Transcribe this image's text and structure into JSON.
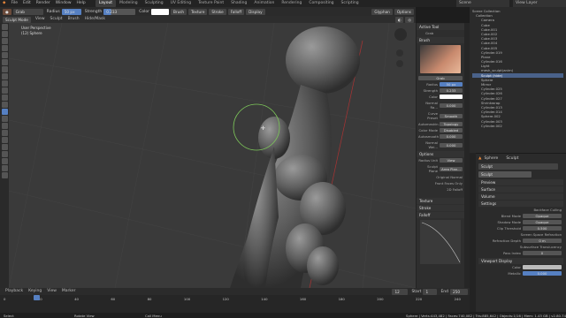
{
  "menu": [
    "File",
    "Edit",
    "Render",
    "Window",
    "Help"
  ],
  "workspaces": [
    "Layout",
    "Modeling",
    "Sculpting",
    "UV Editing",
    "Texture Paint",
    "Shading",
    "Animation",
    "Rendering",
    "Compositing",
    "Scripting"
  ],
  "scene_label": "Scene",
  "view_layer_label": "View Layer",
  "toolbar": {
    "brush": "Grab",
    "radius_label": "Radius",
    "radius": "50 px",
    "strength_label": "Strength",
    "strength": "0.233",
    "color_label": "Color",
    "brush_btn": "Brush",
    "texture_btn": "Texture",
    "stroke_btn": "Stroke",
    "falloff_btn": "Falloff",
    "display_btn": "Display",
    "orientation": "Glyphan",
    "options_btn": "Options"
  },
  "header3": {
    "mode": "Sculpt Mode",
    "view": "View",
    "sculpt": "Sculpt",
    "brush": "Brush",
    "hide_mask": "Hide/Mask"
  },
  "viewport": {
    "perspective": "User Perspective",
    "object": "(12) Sphere"
  },
  "npanel": {
    "active_tool": "Active Tool",
    "tool_name": "Grab",
    "brush_header": "Brush",
    "brush_name": "Grab",
    "radius_label": "Radius",
    "radius": "50 px",
    "strength_label": "Strength",
    "strength": "0.233",
    "color_label": "Color",
    "normal_radius_label": "Normal Ra...",
    "normal_radius": "0.000",
    "curve_preset_label": "Curve Preset",
    "curve_preset": "Smooth",
    "automasking_label": "Automaskin...",
    "automasking": "Topology",
    "color_mode_label": "Color Mode",
    "color_mode": "Disabled",
    "autosmooth_label": "Autosmooth",
    "autosmooth": "0.000",
    "normal_wei_label": "Normal Wei...",
    "normal_wei": "0.000",
    "options_header": "Options",
    "radius_unit_label": "Radius Unit",
    "radius_unit": "View",
    "sculpt_plane_label": "Sculpt Plane",
    "sculpt_plane": "Area Plan...",
    "original_normal": "Original Normal",
    "front_faces_only": "Front Faces Only",
    "falloff_2d": "2D Falloff",
    "texture_header": "Texture",
    "stroke_header": "Stroke",
    "falloff_header": "Falloff"
  },
  "outliner": {
    "title": "Scene Collection",
    "items": [
      "Collection",
      "Camera",
      "Cube",
      "Cube.001",
      "Cube.002",
      "Cube.003",
      "Cube.004",
      "Cube.005",
      "Cylinder.019",
      "Plane",
      "Cylinder.016",
      "Light",
      "mesh_sculpt(anim)",
      "Sculpt (hide)",
      "Sphere",
      "Mirror",
      "Cylinder.025",
      "Cylinder.026",
      "Cylinder.027",
      "Shrinkwrap",
      "Cylinder.013",
      "Cylinder.014",
      "Sphere.002",
      "Cylinder.003",
      "Cylinder.002"
    ]
  },
  "properties": {
    "object": "Sphere",
    "tab": "Sculpt",
    "material": "Sculpt",
    "sections": [
      "Preview",
      "Surface",
      "Volume",
      "Settings"
    ],
    "backface_culling": "Backface Culling",
    "blend_mode_label": "Blend Mode",
    "blend_mode": "Opaque",
    "shadow_mode_label": "Shadow Mode",
    "shadow_mode": "Opaque",
    "clip_threshold_label": "Clip Threshold",
    "clip_threshold": "0.500",
    "screen_space_refraction": "Screen Space Refraction",
    "refraction_depth_label": "Refraction Depth",
    "refraction_depth": "0 m",
    "subsurface_translucency": "Subsurface Translucency",
    "pass_index_label": "Pass Index",
    "pass_index": "0",
    "viewport_display": "Viewport Display",
    "color_label": "Color",
    "metallic_label": "Metallic",
    "metallic": "0.000"
  },
  "timeline": {
    "playback": "Playback",
    "keying": "Keying",
    "view": "View",
    "marker": "Marker",
    "current": "12",
    "start_label": "Start",
    "start": "1",
    "end_label": "End",
    "end": "250",
    "ticks": [
      "0",
      "20",
      "40",
      "60",
      "80",
      "100",
      "120",
      "140",
      "160",
      "180",
      "200",
      "220",
      "240"
    ]
  },
  "status": {
    "select": "Select",
    "rotate": "Rotate View",
    "menu": "Call Menu",
    "info": "Sphere | Verts:443,482 | Faces:740,082 | Tris:885,642 | Objects:1/16 | Mem: 1.43 GB | v2.80.74"
  },
  "colors": {
    "accent": "#4a628a",
    "circle": "#7ec85a"
  }
}
